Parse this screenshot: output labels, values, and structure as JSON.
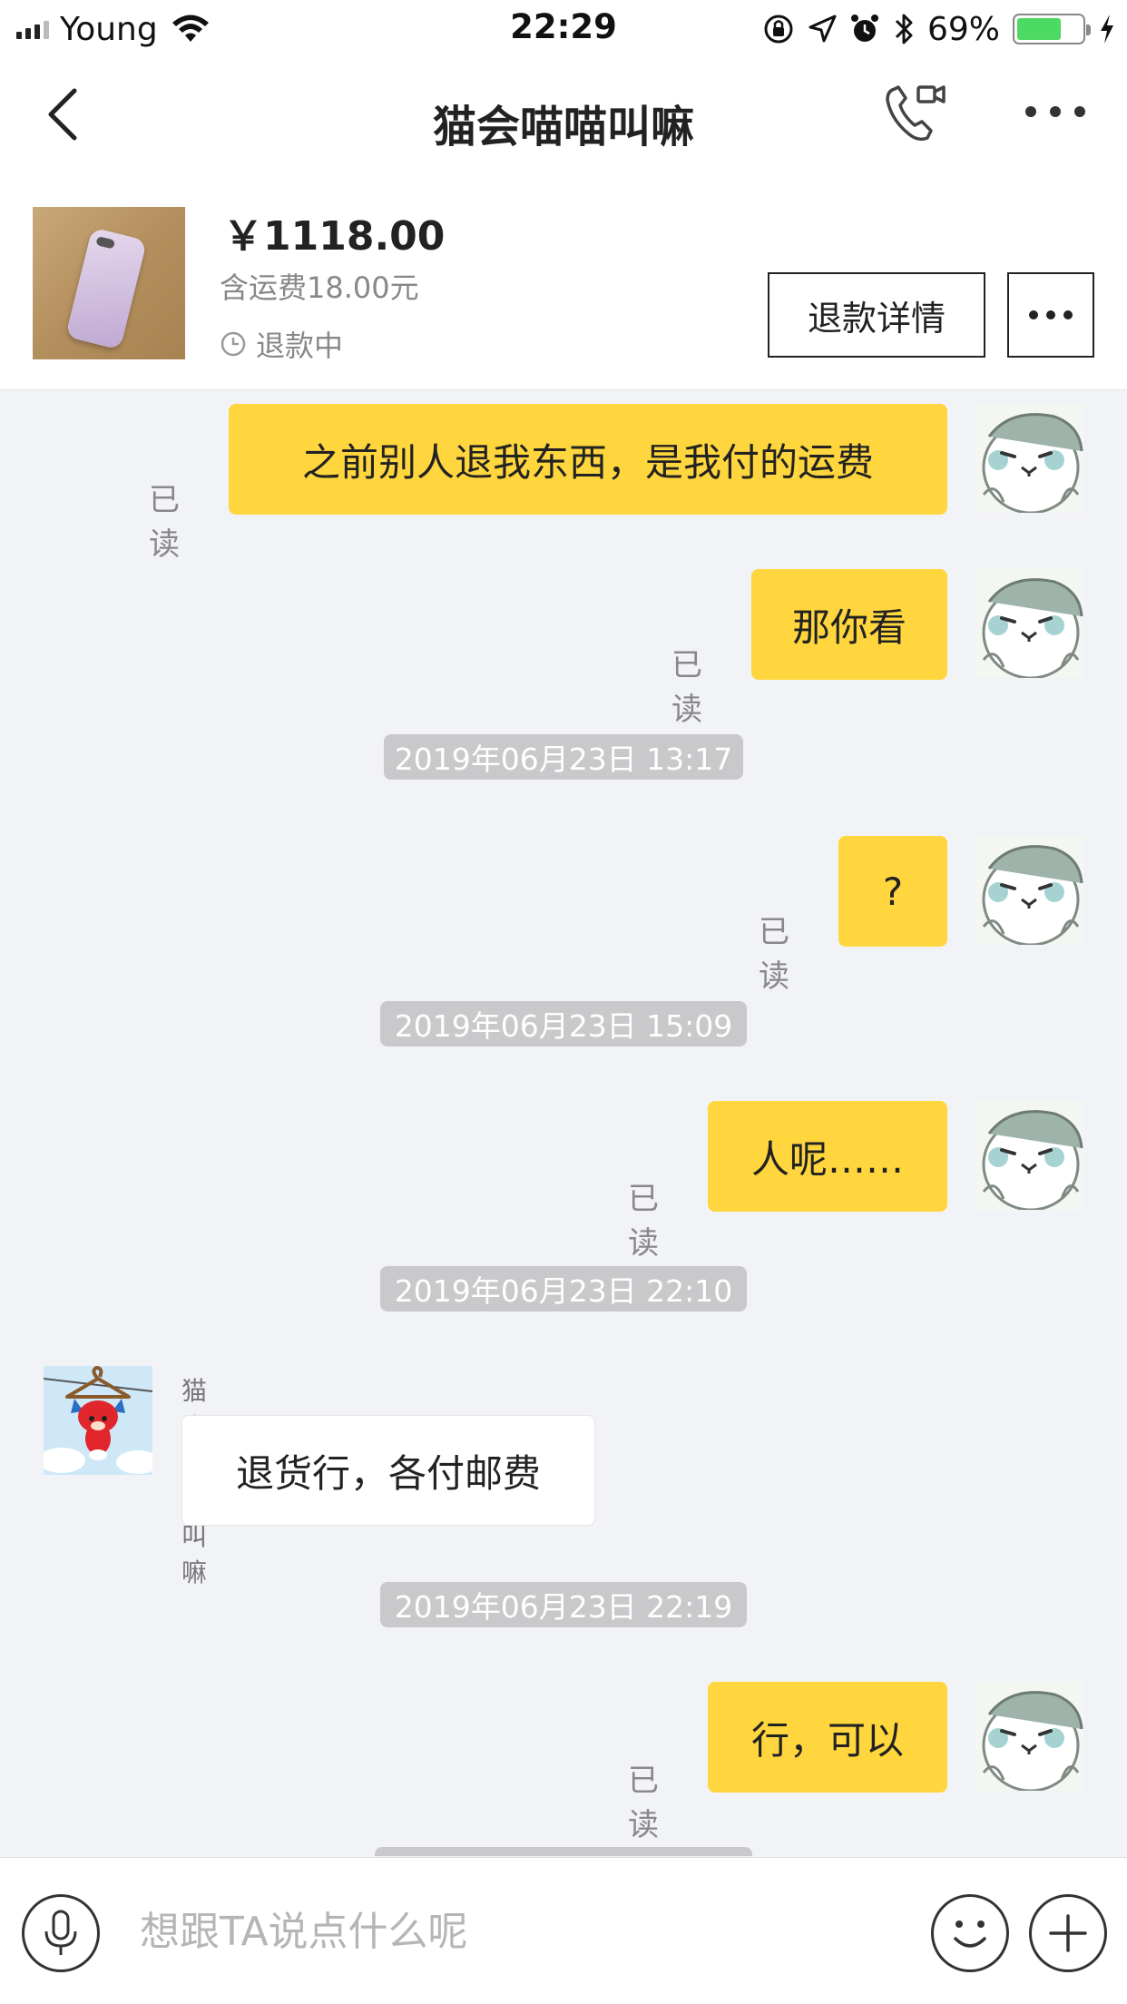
{
  "status_bar": {
    "carrier": "Young",
    "time": "22:29",
    "battery_percent": "69%",
    "battery_level": 0.69,
    "battery_color": "#4cd964"
  },
  "nav": {
    "title": "猫会喵喵叫嘛",
    "icons": [
      "chevron-left-icon",
      "video-call-icon",
      "more-dots-icon"
    ]
  },
  "order": {
    "price": "￥1118.00",
    "shipping_note": "含运费18.00元",
    "status": "退款中",
    "refund_detail_label": "退款详情"
  },
  "chat": {
    "accent_color": "#ffd63d",
    "messages": [
      {
        "from": "me",
        "text": "之前别人退我东西，是我付的运费",
        "read": "已读"
      },
      {
        "from": "me",
        "text": "那你看",
        "read": "已读"
      },
      {
        "timestamp": "2019年06月23日 13:17"
      },
      {
        "from": "me",
        "text": "?",
        "read": "已读"
      },
      {
        "timestamp": "2019年06月23日 15:09"
      },
      {
        "from": "me",
        "text": "人呢……",
        "read": "已读"
      },
      {
        "timestamp": "2019年06月23日 22:10"
      },
      {
        "from": "them",
        "sender": "猫会喵喵叫嘛",
        "text": "退货行，各付邮费"
      },
      {
        "timestamp": "2019年06月23日 22:19"
      },
      {
        "from": "me",
        "text": "行，可以",
        "read": "已读"
      }
    ]
  },
  "input": {
    "placeholder": "想跟TA说点什么呢",
    "icons": [
      "microphone-icon",
      "emoji-icon",
      "plus-icon"
    ]
  }
}
